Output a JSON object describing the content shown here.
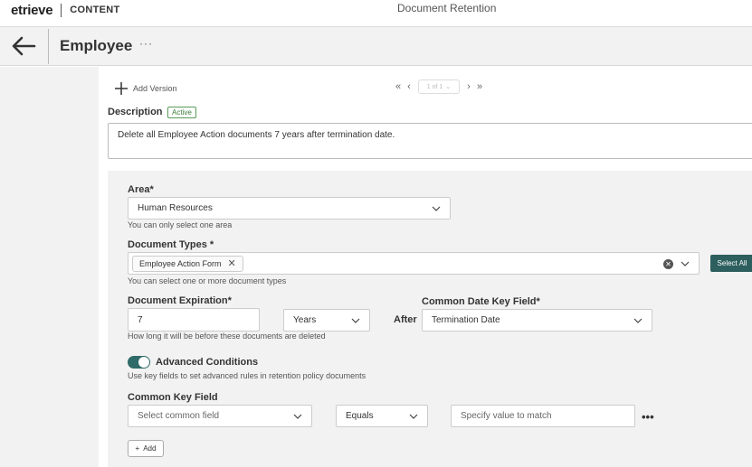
{
  "app": {
    "logo": "etrieve",
    "module": "CONTENT",
    "window_title": "Document Retention"
  },
  "header": {
    "title": "Employee",
    "more": "···"
  },
  "version": {
    "add_label": "Add Version",
    "pager_value": "1 of 1"
  },
  "description": {
    "label": "Description",
    "status": "Active",
    "text": "Delete all Employee Action documents 7 years after termination date."
  },
  "area": {
    "label": "Area",
    "required": "*",
    "value": "Human Resources",
    "hint": "You can only select one area"
  },
  "document_types": {
    "label": "Document Types",
    "required": " *",
    "chips": [
      "Employee Action Form"
    ],
    "hint": "You can select one or more document types",
    "select_all_label": "Select All"
  },
  "expiration": {
    "label": "Document Expiration",
    "required": "*",
    "value": "7",
    "unit": "Years",
    "after_label": "After",
    "hint": "How long it will be before these documents are deleted"
  },
  "common_date": {
    "label": "Common Date Key Field",
    "required": "*",
    "value": "Termination Date"
  },
  "advanced": {
    "label": "Advanced Conditions",
    "enabled": true,
    "hint": "Use key fields to set advanced rules in retention policy documents"
  },
  "common_key": {
    "label": "Common Key Field",
    "field_placeholder": "Select common field",
    "operator": "Equals",
    "value_placeholder": "Specify value to match",
    "more": "•••"
  },
  "add_button": {
    "label": "Add"
  },
  "colors": {
    "accent": "#2c5f5d",
    "badge": "#3a7a3a",
    "panel": "#f2f2f2"
  }
}
